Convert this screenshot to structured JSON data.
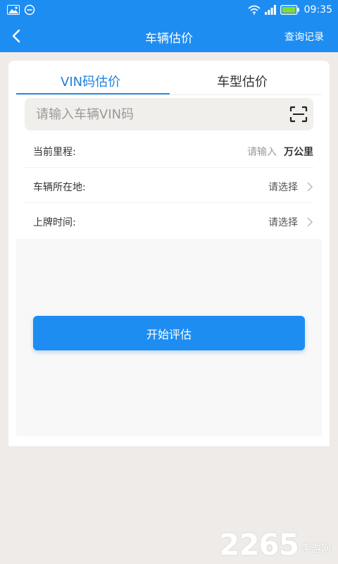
{
  "status_bar": {
    "time": "09:35",
    "icons": [
      "image-icon",
      "minus-circle-icon",
      "wifi-icon",
      "signal-icon",
      "battery-icon"
    ]
  },
  "nav": {
    "title": "车辆估价",
    "right_link": "查询记录"
  },
  "tabs": [
    {
      "label": "VIN码估价",
      "active": true
    },
    {
      "label": "车型估价",
      "active": false
    }
  ],
  "vin_input": {
    "placeholder": "请输入车辆VIN码",
    "value": ""
  },
  "form": {
    "mileage": {
      "label": "当前里程:",
      "hint": "请输入",
      "unit": "万公里"
    },
    "location": {
      "label": "车辆所在地:",
      "value": "请选择"
    },
    "plate_date": {
      "label": "上牌时间:",
      "value": "请选择"
    }
  },
  "submit_label": "开始评估",
  "watermark": {
    "number": "2265",
    "text": "手游网"
  },
  "colors": {
    "primary": "#1e8df2",
    "tab_active": "#1e7fe0",
    "page_bg": "#eeebe8"
  }
}
